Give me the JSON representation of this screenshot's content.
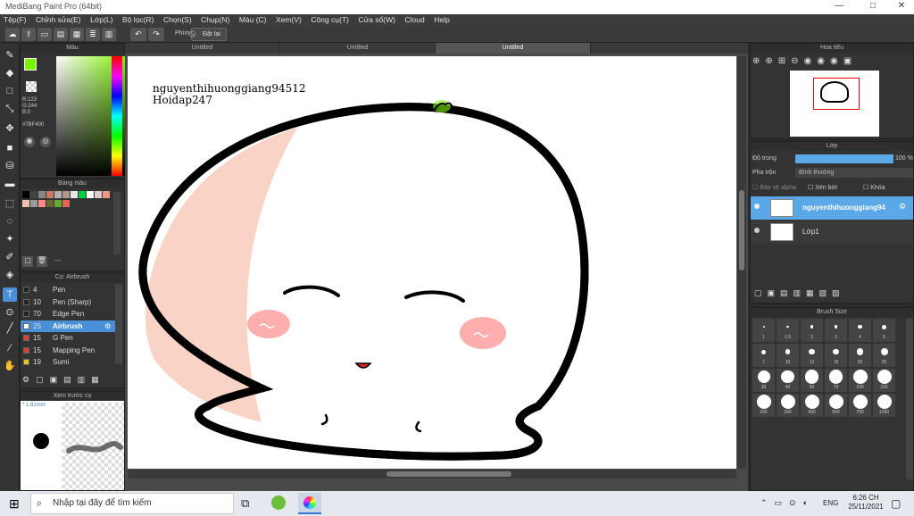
{
  "titlebar": {
    "title": "MediBang Paint Pro (64bit)",
    "minimize": "—",
    "maximize": "□",
    "close": "✕"
  },
  "menu": [
    "Tệp(F)",
    "Chỉnh sửa(E)",
    "Lớp(L)",
    "Bộ lọc(R)",
    "Chọn(S)",
    "Chụp(N)",
    "Màu (C)",
    "Xem(V)",
    "Công cụ(T)",
    "Cửa sổ(W)",
    "Cloud",
    "Help"
  ],
  "toolbar": {
    "phim_label": "Phím",
    "reset_label": "Đặt lại"
  },
  "color_panel": {
    "title": "Màu",
    "r": "R:123",
    "g": "G:244",
    "b": "B:0",
    "hex": "#7BF400",
    "fg": "#7BF400",
    "bg": "#000000"
  },
  "palette_panel": {
    "title": "Bảng màu",
    "footer": "---",
    "swatches": [
      "#000000",
      "#444444",
      "#888888",
      "#cc7766",
      "#b0b0b0",
      "#aa9988",
      "#e8e8e8",
      "#00cc44",
      "#ffffff",
      "#ddcccc",
      "#ee9988",
      "#eec0b0",
      "#999999",
      "#ff8888",
      "#666633",
      "#66aa33",
      "#dd6655"
    ]
  },
  "brush_panel": {
    "title": "Cọ: Airbrush",
    "items": [
      {
        "size": "4",
        "name": "Pen",
        "color": "#222222"
      },
      {
        "size": "10",
        "name": "Pen (Sharp)",
        "color": "#222222"
      },
      {
        "size": "70",
        "name": "Edge Pen",
        "color": "#222222"
      },
      {
        "size": "25",
        "name": "Airbrush",
        "color": "#ffffff",
        "active": true
      },
      {
        "size": "15",
        "name": "G Pen",
        "color": "#e23b3b"
      },
      {
        "size": "15",
        "name": "Mapping Pen",
        "color": "#e23b3b"
      },
      {
        "size": "19",
        "name": "Sumi",
        "color": "#e6c31e"
      }
    ]
  },
  "preview_panel": {
    "title": "Xem trước cọ",
    "size": "* 1.81mm"
  },
  "tabs": [
    "Untitled",
    "Untitled",
    "Untitled"
  ],
  "canvas": {
    "text1": "nguyenthihuonggiang94512",
    "text2": "Hoidap247"
  },
  "navigator": {
    "title": "Hoa tiêu"
  },
  "layer_panel": {
    "title": "Lớp",
    "opacity_label": "Độ trong",
    "opacity_value": "100 %",
    "opacity": 100,
    "blend_label": "Pha trộn",
    "blend_value": "Bình thường",
    "protect_alpha": "Bảo vệ alpha",
    "clip": "Xén bớt",
    "lock": "Khóa",
    "layers": [
      {
        "name": "nguyenthihuonggiang94",
        "active": true
      },
      {
        "name": "Lớp1",
        "active": false
      }
    ]
  },
  "brush_size_panel": {
    "title": "Brush Size",
    "sizes": [
      "1",
      "1.5",
      "2",
      "3",
      "4",
      "5",
      "7",
      "10",
      "12",
      "15",
      "20",
      "25",
      "30",
      "40",
      "50",
      "70",
      "100",
      "150",
      "200",
      "300",
      "400",
      "500",
      "700",
      "1000"
    ]
  },
  "taskbar": {
    "search_placeholder": "Nhập tại đây để tìm kiếm",
    "lang": "ENG",
    "time": "6:26 CH",
    "date": "25/11/2021"
  }
}
